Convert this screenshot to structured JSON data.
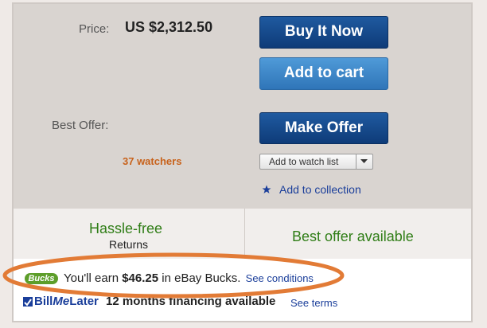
{
  "price": {
    "label": "Price:",
    "value": "US $2,312.50"
  },
  "buttons": {
    "buy_now": "Buy It Now",
    "add_to_cart": "Add to cart",
    "make_offer": "Make Offer"
  },
  "best_offer": {
    "label": "Best Offer:"
  },
  "watchers": "37 watchers",
  "watch_list": {
    "label": "Add to watch list"
  },
  "collection": {
    "label": "Add to collection"
  },
  "features": {
    "hassle_free": {
      "title": "Hassle-free",
      "subtitle": "Returns"
    },
    "best_offer": "Best offer available"
  },
  "ebay_bucks": {
    "badge": "Bucks",
    "prefix": "You'll earn",
    "amount": "$46.25",
    "suffix": "in eBay Bucks.",
    "link": "See conditions"
  },
  "financing": {
    "logo_bill": "Bill",
    "logo_me": "Me",
    "logo_later": "Later",
    "text": "12 months financing available",
    "link": "See terms"
  },
  "colors": {
    "primary_button": "#0e3b78",
    "secondary_button": "#2f75b8",
    "watchers": "#c8621b",
    "green_text": "#2f7d16",
    "link": "#1a3e9a",
    "oval": "#e27b36"
  }
}
